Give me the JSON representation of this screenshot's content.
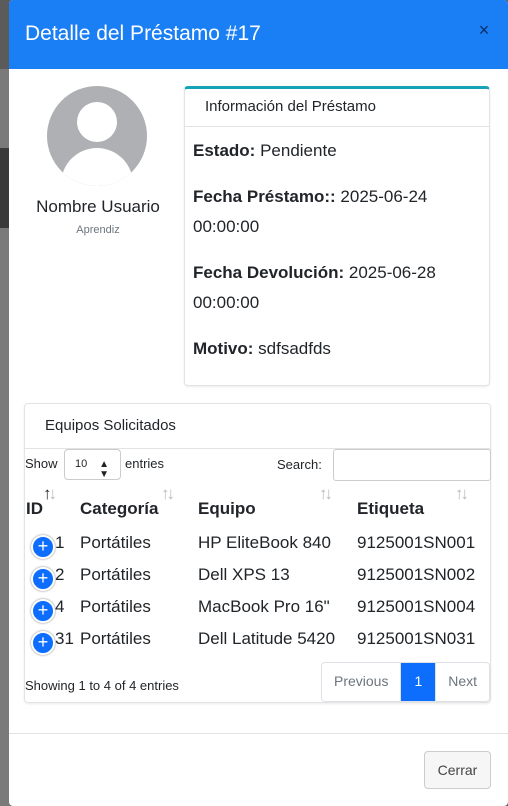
{
  "modal": {
    "title": "Detalle del Préstamo #17",
    "close_icon": "×"
  },
  "user": {
    "name": "Nombre Usuario",
    "role": "Aprendiz"
  },
  "loan_info": {
    "header": "Información del Préstamo",
    "estado_label": "Estado:",
    "estado_value": "Pendiente",
    "fecha_prestamo_label": "Fecha Préstamo::",
    "fecha_prestamo_value": "2025-06-24 00:00:00",
    "fecha_devolucion_label": "Fecha Devolución:",
    "fecha_devolucion_value": "2025-06-28 00:00:00",
    "motivo_label": "Motivo:",
    "motivo_value": "sdfsadfds"
  },
  "equipment": {
    "header": "Equipos Solicitados",
    "show_label": "Show",
    "page_length": "10",
    "entries_label": "entries",
    "search_label": "Search:",
    "columns": [
      "ID",
      "Categoría",
      "Equipo",
      "Etiqueta"
    ],
    "rows": [
      {
        "id": "1",
        "categoria": "Portátiles",
        "equipo": "HP EliteBook 840",
        "etiqueta": "9125001SN001"
      },
      {
        "id": "2",
        "categoria": "Portátiles",
        "equipo": "Dell XPS 13",
        "etiqueta": "9125001SN002"
      },
      {
        "id": "4",
        "categoria": "Portátiles",
        "equipo": "MacBook Pro 16\"",
        "etiqueta": "9125001SN004"
      },
      {
        "id": "31",
        "categoria": "Portátiles",
        "equipo": "Dell Latitude 5420",
        "etiqueta": "9125001SN031"
      }
    ],
    "info": "Showing 1 to 4 of 4 entries",
    "pagination": {
      "previous": "Previous",
      "current": "1",
      "next": "Next"
    }
  },
  "footer": {
    "close_label": "Cerrar"
  },
  "colors": {
    "header_bg": "#1a7ef5",
    "card_accent": "#17a2b8",
    "primary": "#0d6efd"
  }
}
